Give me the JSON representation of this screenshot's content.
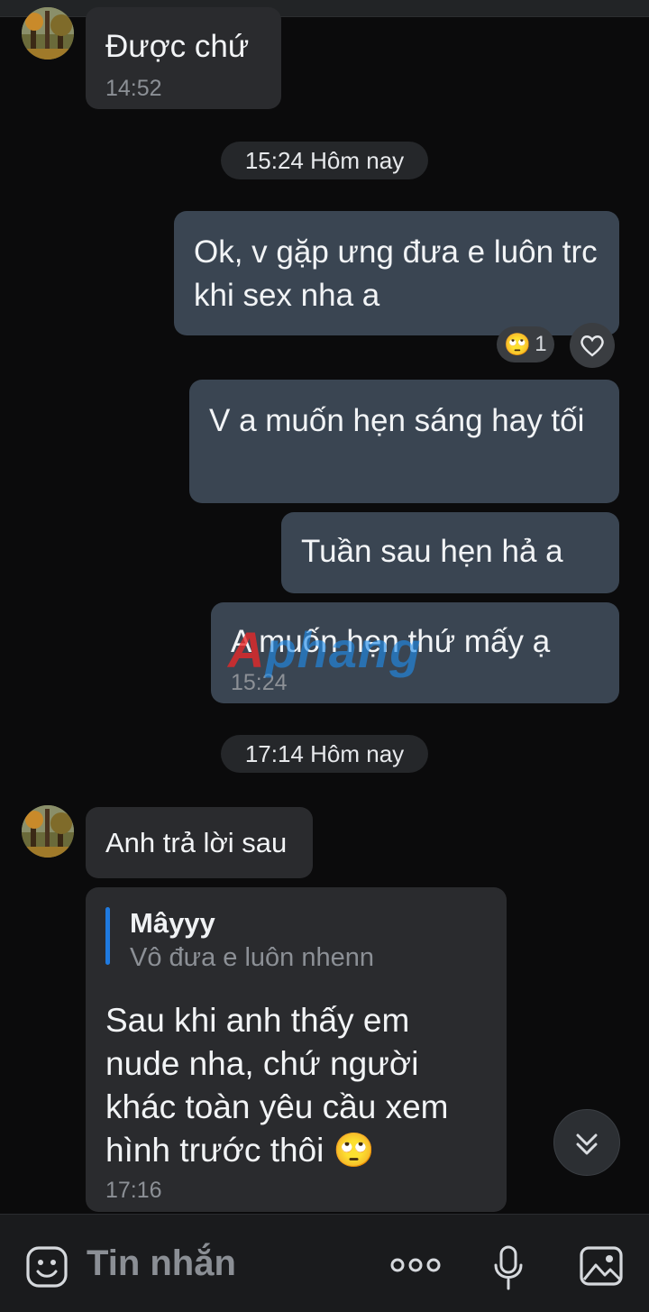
{
  "messages": {
    "m1": {
      "text": "Được chứ",
      "time": "14:52"
    },
    "divider1": "15:24 Hôm nay",
    "m2": {
      "text": "Ok, v gặp ưng đưa e luôn trc khi sex nha a",
      "reaction_count": "1"
    },
    "m3": {
      "text": "V a muốn hẹn sáng hay tối"
    },
    "m4": {
      "text": "Tuần sau hẹn hả a"
    },
    "m5": {
      "text": "A muốn hẹn thứ mấy ạ",
      "time": "15:24"
    },
    "divider2": "17:14 Hôm nay",
    "m6": {
      "text": "Anh trả lời sau"
    },
    "m7": {
      "quote_author": "Mâyyy",
      "quote_text": "Vô đưa e luôn nhenn",
      "text": "Sau khi anh thấy em nude nha, chứ người khác toàn yêu cầu xem hình trước thôi",
      "emoji": "🙄",
      "time": "17:16"
    }
  },
  "watermark": {
    "first": "A",
    "rest": "phang"
  },
  "composer": {
    "placeholder": "Tin nhắn"
  },
  "icons": {
    "sticker": "sticker-icon",
    "more": "more-icon",
    "mic": "microphone-icon",
    "image": "image-icon",
    "scroll": "scroll-down-icon",
    "heart": "heart-icon"
  },
  "colors": {
    "accent": "#1f7ae0",
    "outgoing": "#3a4552",
    "incoming": "#2a2b2e"
  }
}
